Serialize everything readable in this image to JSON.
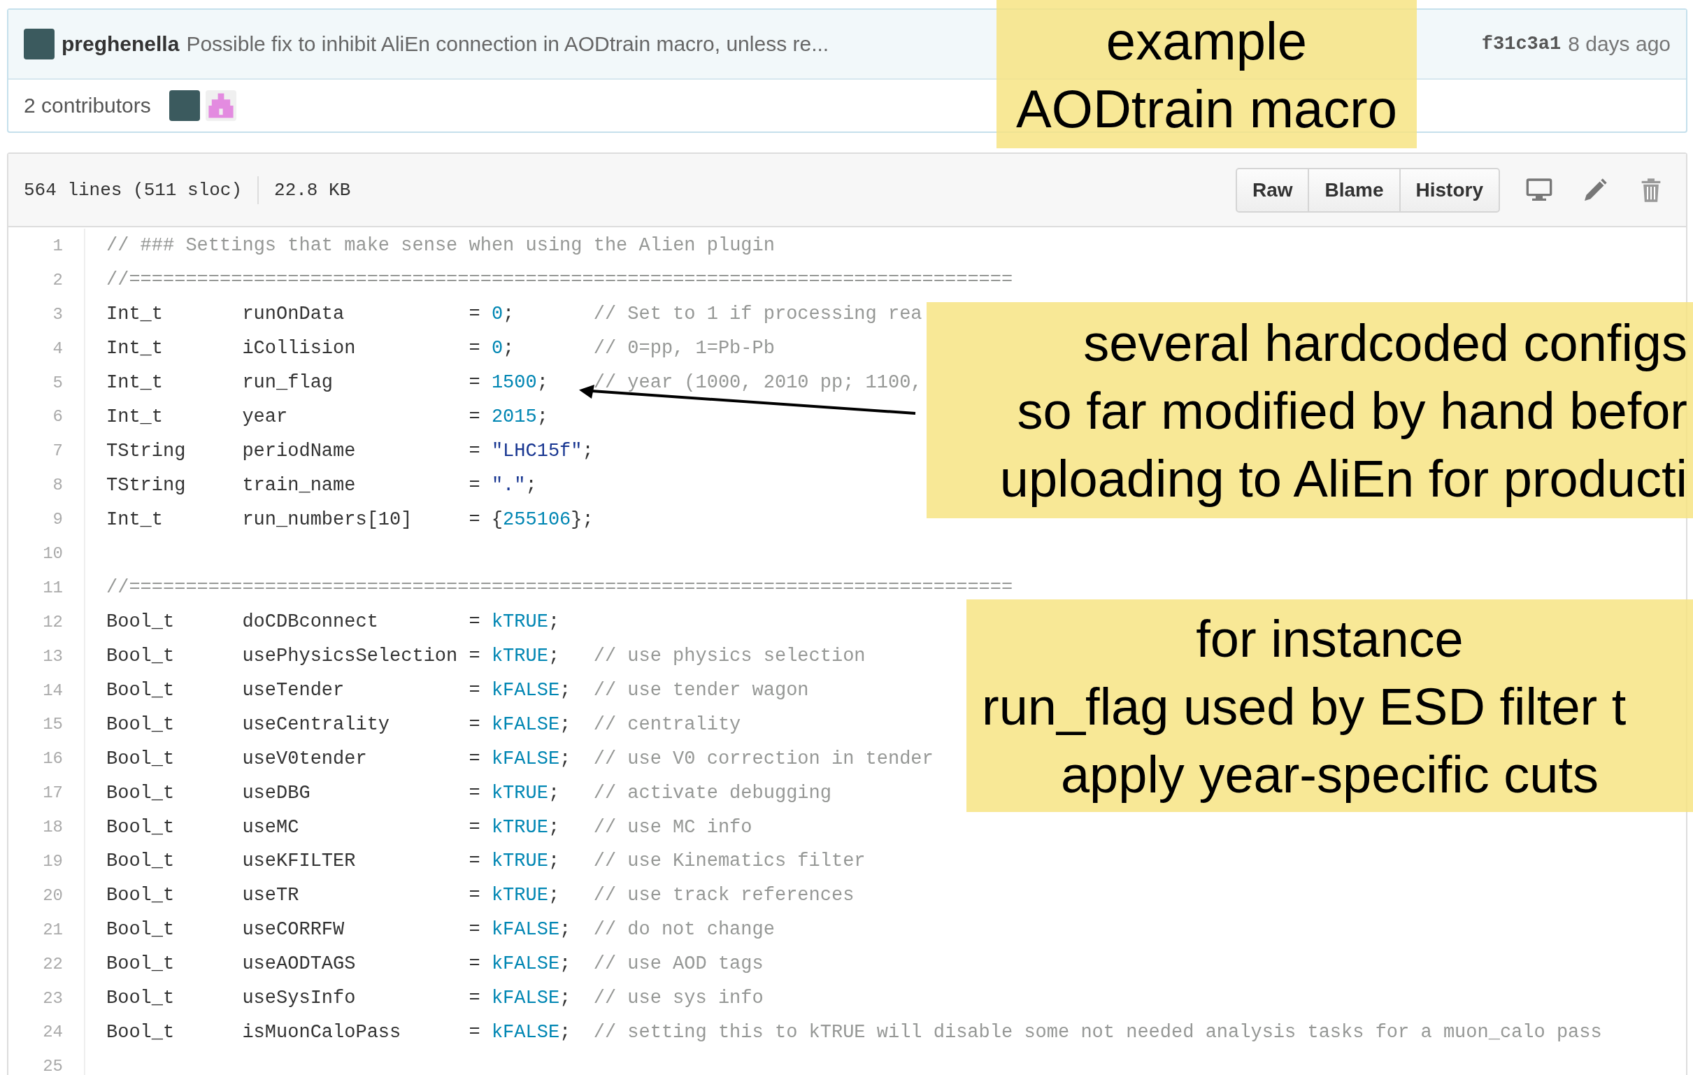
{
  "commit": {
    "author": "preghenella",
    "message": "Possible fix to inhibit AliEn connection in AODtrain macro, unless re...",
    "sha": "f31c3a1",
    "time": "8 days ago"
  },
  "contributors": {
    "label": "2 contributors",
    "avatars": [
      {
        "kind": "photo"
      },
      {
        "kind": "identicon",
        "color": "#e38be0"
      }
    ]
  },
  "file_info": {
    "lines": "564 lines (511 sloc)",
    "size": "22.8 KB"
  },
  "actions": [
    "Raw",
    "Blame",
    "History"
  ],
  "tools": [
    {
      "kind": "desktop"
    },
    {
      "kind": "edit"
    },
    {
      "kind": "delete"
    }
  ],
  "code": [
    {
      "n": "1",
      "comment": "// ### Settings that make sense when using the Alien plugin"
    },
    {
      "n": "2",
      "comment": "//=============================================================================="
    },
    {
      "n": "3",
      "type": "Int_t",
      "name": "runOnData",
      "value": [
        {
          "kind": "op",
          "text": "= "
        },
        {
          "kind": "num",
          "text": "0"
        },
        {
          "kind": "op",
          "text": ";"
        }
      ],
      "comment": "// Set to 1 if processing rea"
    },
    {
      "n": "4",
      "type": "Int_t",
      "name": "iCollision",
      "value": [
        {
          "kind": "op",
          "text": "= "
        },
        {
          "kind": "num",
          "text": "0"
        },
        {
          "kind": "op",
          "text": ";"
        }
      ],
      "comment": "// 0=pp, 1=Pb-Pb"
    },
    {
      "n": "5",
      "type": "Int_t",
      "name": "run_flag",
      "value": [
        {
          "kind": "op",
          "text": "= "
        },
        {
          "kind": "num",
          "text": "1500"
        },
        {
          "kind": "op",
          "text": ";"
        }
      ],
      "comment": "// year (1000, 2010 pp; 1100,"
    },
    {
      "n": "6",
      "type": "Int_t",
      "name": "year",
      "value": [
        {
          "kind": "op",
          "text": "= "
        },
        {
          "kind": "num",
          "text": "2015"
        },
        {
          "kind": "op",
          "text": ";"
        }
      ]
    },
    {
      "n": "7",
      "type": "TString",
      "name": "periodName",
      "value": [
        {
          "kind": "op",
          "text": "= "
        },
        {
          "kind": "str",
          "text": "\"LHC15f\""
        },
        {
          "kind": "op",
          "text": ";"
        }
      ]
    },
    {
      "n": "8",
      "type": "TString",
      "name": "train_name",
      "value": [
        {
          "kind": "op",
          "text": "= "
        },
        {
          "kind": "str",
          "text": "\".\""
        },
        {
          "kind": "op",
          "text": ";"
        }
      ]
    },
    {
      "n": "9",
      "type": "Int_t",
      "name": "run_numbers[10]",
      "value": [
        {
          "kind": "op",
          "text": "= {"
        },
        {
          "kind": "num",
          "text": "255106"
        },
        {
          "kind": "op",
          "text": "};"
        }
      ]
    },
    {
      "n": "10"
    },
    {
      "n": "11",
      "comment": "//=============================================================================="
    },
    {
      "n": "12",
      "type": "Bool_t",
      "name": "doCDBconnect",
      "value": [
        {
          "kind": "op",
          "text": "= "
        },
        {
          "kind": "num",
          "text": "kTRUE"
        },
        {
          "kind": "op",
          "text": ";"
        }
      ]
    },
    {
      "n": "13",
      "type": "Bool_t",
      "name": "usePhysicsSelection",
      "value": [
        {
          "kind": "op",
          "text": "= "
        },
        {
          "kind": "num",
          "text": "kTRUE"
        },
        {
          "kind": "op",
          "text": ";"
        }
      ],
      "comment": "// use physics selection"
    },
    {
      "n": "14",
      "type": "Bool_t",
      "name": "useTender",
      "value": [
        {
          "kind": "op",
          "text": "= "
        },
        {
          "kind": "num",
          "text": "kFALSE"
        },
        {
          "kind": "op",
          "text": ";"
        }
      ],
      "comment": "// use tender wagon"
    },
    {
      "n": "15",
      "type": "Bool_t",
      "name": "useCentrality",
      "value": [
        {
          "kind": "op",
          "text": "= "
        },
        {
          "kind": "num",
          "text": "kFALSE"
        },
        {
          "kind": "op",
          "text": ";"
        }
      ],
      "comment": "// centrality"
    },
    {
      "n": "16",
      "type": "Bool_t",
      "name": "useV0tender",
      "value": [
        {
          "kind": "op",
          "text": "= "
        },
        {
          "kind": "num",
          "text": "kFALSE"
        },
        {
          "kind": "op",
          "text": ";"
        }
      ],
      "comment": "// use V0 correction in tender"
    },
    {
      "n": "17",
      "type": "Bool_t",
      "name": "useDBG",
      "value": [
        {
          "kind": "op",
          "text": "= "
        },
        {
          "kind": "num",
          "text": "kTRUE"
        },
        {
          "kind": "op",
          "text": ";"
        }
      ],
      "comment": "// activate debugging"
    },
    {
      "n": "18",
      "type": "Bool_t",
      "name": "useMC",
      "value": [
        {
          "kind": "op",
          "text": "= "
        },
        {
          "kind": "num",
          "text": "kTRUE"
        },
        {
          "kind": "op",
          "text": ";"
        }
      ],
      "comment": "// use MC info"
    },
    {
      "n": "19",
      "type": "Bool_t",
      "name": "useKFILTER",
      "value": [
        {
          "kind": "op",
          "text": "= "
        },
        {
          "kind": "num",
          "text": "kTRUE"
        },
        {
          "kind": "op",
          "text": ";"
        }
      ],
      "comment": "// use Kinematics filter"
    },
    {
      "n": "20",
      "type": "Bool_t",
      "name": "useTR",
      "value": [
        {
          "kind": "op",
          "text": "= "
        },
        {
          "kind": "num",
          "text": "kTRUE"
        },
        {
          "kind": "op",
          "text": ";"
        }
      ],
      "comment": "// use track references"
    },
    {
      "n": "21",
      "type": "Bool_t",
      "name": "useCORRFW",
      "value": [
        {
          "kind": "op",
          "text": "= "
        },
        {
          "kind": "num",
          "text": "kFALSE"
        },
        {
          "kind": "op",
          "text": ";"
        }
      ],
      "comment": "// do not change"
    },
    {
      "n": "22",
      "type": "Bool_t",
      "name": "useAODTAGS",
      "value": [
        {
          "kind": "op",
          "text": "= "
        },
        {
          "kind": "num",
          "text": "kFALSE"
        },
        {
          "kind": "op",
          "text": ";"
        }
      ],
      "comment": "// use AOD tags"
    },
    {
      "n": "23",
      "type": "Bool_t",
      "name": "useSysInfo",
      "value": [
        {
          "kind": "op",
          "text": "= "
        },
        {
          "kind": "num",
          "text": "kFALSE"
        },
        {
          "kind": "op",
          "text": ";"
        }
      ],
      "comment": "// use sys info"
    },
    {
      "n": "24",
      "type": "Bool_t",
      "name": "isMuonCaloPass",
      "value": [
        {
          "kind": "op",
          "text": "= "
        },
        {
          "kind": "num",
          "text": "kFALSE"
        },
        {
          "kind": "op",
          "text": ";"
        }
      ],
      "comment": "// setting this to kTRUE will disable some not needed analysis tasks for a muon_calo pass"
    },
    {
      "n": "25"
    }
  ],
  "annotations": [
    {
      "lines": [
        "example",
        "AODtrain macro"
      ]
    },
    {
      "lines": [
        "several hardcoded configs",
        "so far modified by hand befor",
        "uploading to AliEn for producti"
      ]
    },
    {
      "lines": [
        "for instance",
        "run_flag used by ESD filter t",
        "apply year-specific cuts"
      ]
    }
  ]
}
